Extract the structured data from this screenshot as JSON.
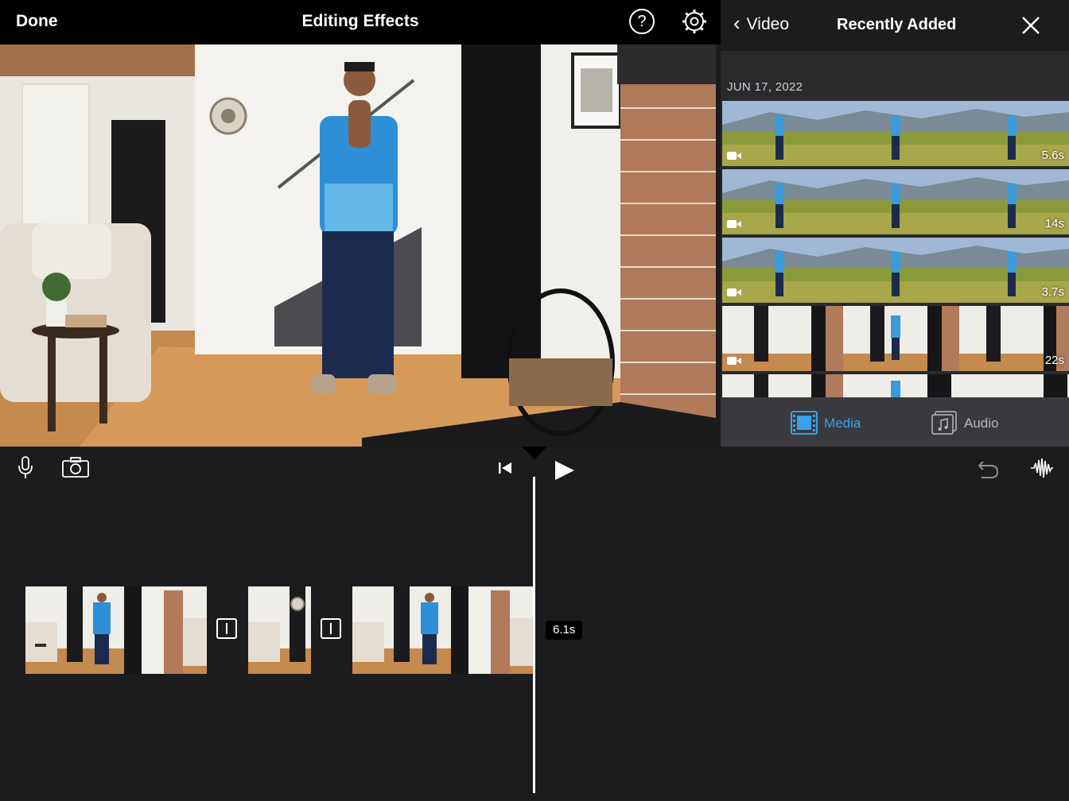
{
  "header": {
    "done_label": "Done",
    "project_title": "Editing Effects",
    "help_label": "?"
  },
  "browser": {
    "back_label": "Video",
    "title": "Recently Added",
    "date_group": "JUN 17, 2022",
    "clips": [
      {
        "duration": "5.6s",
        "scene": "meadow"
      },
      {
        "duration": "14s",
        "scene": "meadow"
      },
      {
        "duration": "3.7s",
        "scene": "meadow"
      },
      {
        "duration": "22s",
        "scene": "living-room"
      }
    ],
    "tabs": [
      {
        "label": "Media",
        "active": true
      },
      {
        "label": "Audio",
        "active": false
      }
    ]
  },
  "timeline": {
    "selected_duration": "6.1s"
  },
  "colors": {
    "accent": "#3aa0e8",
    "background": "#1c1c1e"
  }
}
